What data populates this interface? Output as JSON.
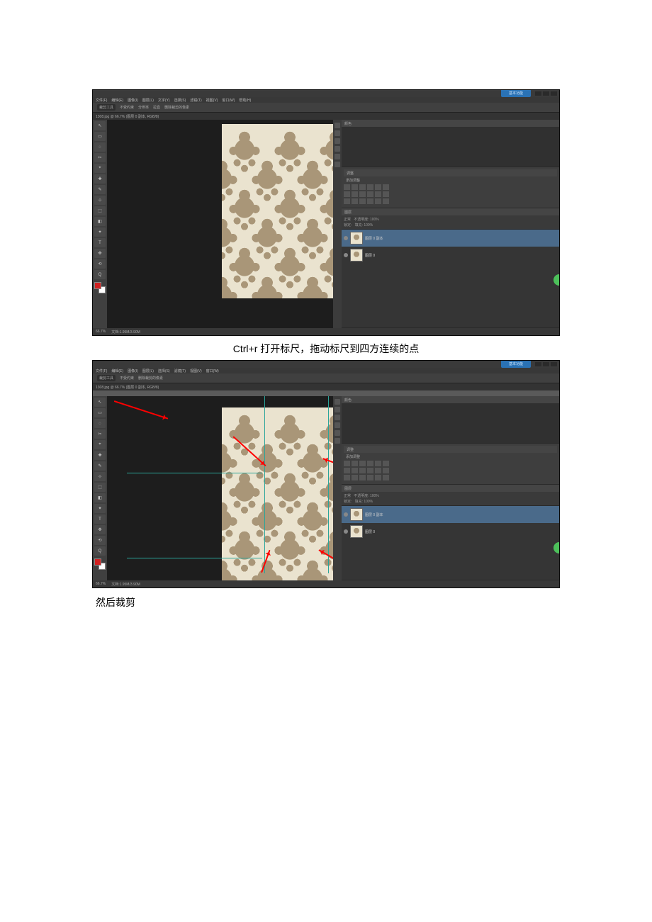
{
  "menubar": [
    "文件(F)",
    "编辑(E)",
    "图像(I)",
    "图层(L)",
    "文字(Y)",
    "选择(S)",
    "滤镜(T)",
    "视图(V)",
    "窗口(W)",
    "帮助(H)"
  ],
  "optionsbar": {
    "tool_preset": "裁剪工具",
    "items": [
      "不受约束",
      "宽度",
      "高度",
      "分辨率",
      "前面的图像",
      "拉直",
      "删除裁剪的像素"
    ]
  },
  "blue_button_label": "基本功能",
  "document_tab": "1308.jpg @ 66.7% (图层 0 副本, RGB/8)",
  "zoom": "66.7%",
  "doc_info": "文档:1.95M/3.90M",
  "tools": [
    "↖",
    "▭",
    "◌",
    "✂",
    "✎",
    "⌖",
    "✚",
    "⊹",
    "T",
    "⬚",
    "✥",
    "◧",
    "✦",
    "⟲",
    "Q"
  ],
  "panels": {
    "color": "颜色",
    "adjust": "调整",
    "adjust_sub": "添加调整",
    "layers": "图层",
    "blend_mode": "正常",
    "opacity_label": "不透明度: 100%",
    "lock_label": "锁定:",
    "fill_label": "填充: 100%",
    "layer_items": [
      {
        "name": "图层 0 副本",
        "selected": true
      },
      {
        "name": "图层 0",
        "selected": false
      }
    ]
  },
  "captions": {
    "ctrlr": "Ctrl+r 打开标尺，拖动标尺到四方连续的点",
    "crop": "然后裁剪"
  }
}
